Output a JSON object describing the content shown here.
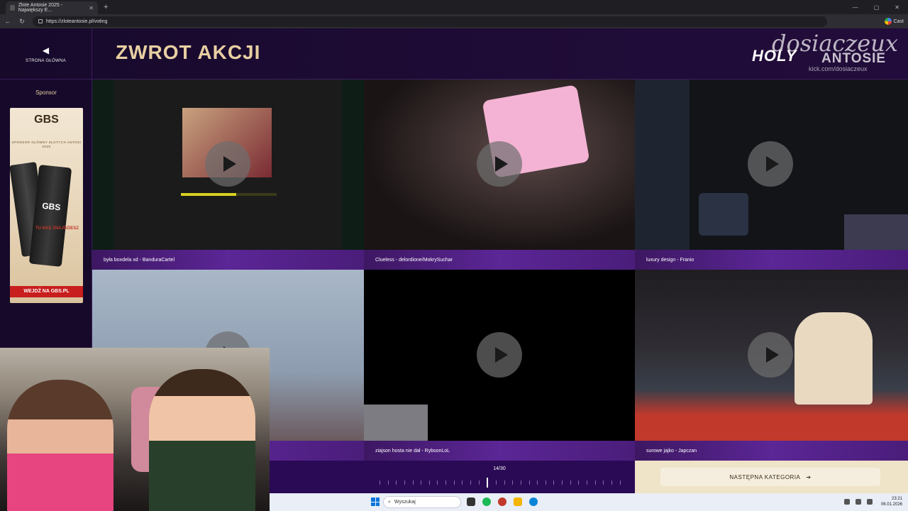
{
  "browser": {
    "tab_title": "Złote Antosie 2025 - Największy E...",
    "url": "https://zloteantosie.pl/voting",
    "cast_label": "Cast"
  },
  "header": {
    "home_label": "STRONA GŁÓWNA",
    "title": "ZWROT AKCJI",
    "logo_holy": "HOLY",
    "logo_antosie": "ANTOSIE",
    "watermark": "dosiaczeux",
    "kick_handle": "kick.com/dosiaczeux"
  },
  "sidebar": {
    "sponsor_label": "Sponsor",
    "ad_brand": "GBS",
    "ad_sub": "SPONSOR GŁÓWNY ZŁOTYCH ANTOSI 2025",
    "ad_can_label": "GBS",
    "ad_badge": "TU NAS ZNAJDZIESZ",
    "ad_cta": "WEJDŹ NA GBS.PL"
  },
  "tiles": [
    {
      "caption": "była boxdela xd - BanduraCartel"
    },
    {
      "caption": "Clueless - delordione/MokrySuchar"
    },
    {
      "caption": "luxury design - Franio"
    },
    {
      "caption": ""
    },
    {
      "caption": "ziajson hosta nie dał - RybsonLoL"
    },
    {
      "caption": "surowe jajko - Japczan"
    }
  ],
  "progress": {
    "label": "14/30",
    "current": 14,
    "total": 30
  },
  "next_button": {
    "label": "NASTĘPNA KATEGORIA"
  },
  "taskbar": {
    "search_placeholder": "Wyszukaj",
    "time": "23:21",
    "date": "06.01.2026"
  }
}
